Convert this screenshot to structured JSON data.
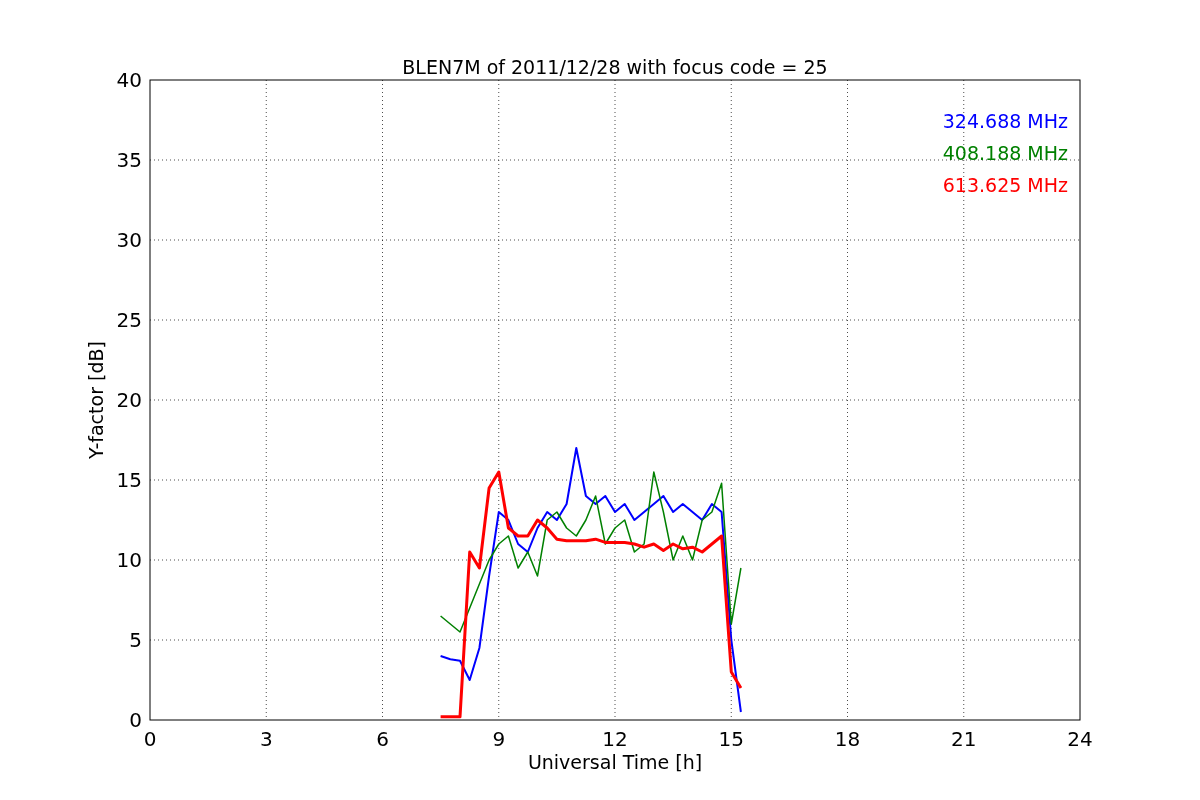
{
  "figure": {
    "chart_data": {
      "type": "line",
      "title": "BLEN7M of 2011/12/28 with focus code = 25",
      "xlabel": "Universal Time [h]",
      "ylabel": "Y-factor [dB]",
      "x": [
        7.5,
        7.75,
        8,
        8.25,
        8.5,
        8.75,
        9,
        9.25,
        9.5,
        9.75,
        10,
        10.25,
        10.5,
        10.75,
        11,
        11.25,
        11.5,
        11.75,
        12,
        12.25,
        12.5,
        12.75,
        13,
        13.25,
        13.5,
        13.75,
        14,
        14.25,
        14.5,
        14.75,
        15,
        15.25
      ],
      "series": [
        {
          "name": "324.688 MHz",
          "color": "#0000ff",
          "values": [
            4,
            3.8,
            3.7,
            2.5,
            4.5,
            9,
            13,
            12.5,
            11,
            10.5,
            12,
            13,
            12.5,
            13.5,
            17,
            14,
            13.5,
            14,
            13,
            13.5,
            12.5,
            13,
            13.5,
            14,
            13,
            13.5,
            13,
            12.5,
            13.5,
            13,
            5,
            0.5
          ]
        },
        {
          "name": "408.188 MHz",
          "color": "#008000",
          "values": [
            6.5,
            6,
            5.5,
            7,
            8.5,
            10,
            11,
            11.5,
            9.5,
            10.5,
            9,
            12.5,
            13,
            12,
            11.5,
            12.5,
            14,
            11,
            12,
            12.5,
            10.5,
            11,
            15.5,
            13,
            10,
            11.5,
            10,
            12.5,
            13,
            14.8,
            6,
            9.5
          ]
        },
        {
          "name": "613.625 MHz",
          "color": "#ff0000",
          "values": [
            0.2,
            0.2,
            0.2,
            10.5,
            9.5,
            14.5,
            15.5,
            12,
            11.5,
            11.5,
            12.5,
            12,
            11.3,
            11.2,
            11.2,
            11.2,
            11.3,
            11.1,
            11.1,
            11.1,
            11,
            10.8,
            11,
            10.6,
            11,
            10.7,
            10.8,
            10.5,
            11,
            11.5,
            3,
            2
          ]
        }
      ],
      "grid": true,
      "xlim": [
        0,
        24
      ],
      "ylim": [
        0,
        40
      ],
      "xticks": [
        0,
        3,
        6,
        9,
        12,
        15,
        18,
        21,
        24
      ],
      "yticks": [
        0,
        5,
        10,
        15,
        20,
        25,
        30,
        35,
        40
      ]
    }
  }
}
